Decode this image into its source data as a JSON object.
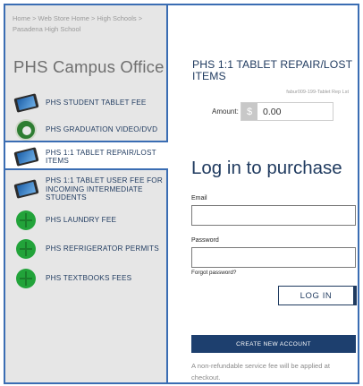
{
  "breadcrumb": "Home > Web Store Home > High Schools > Pasadena High School",
  "campus_title": "PHS Campus Office",
  "sidebar": {
    "items": [
      {
        "label": "PHS STUDENT TABLET FEE",
        "icon": "tablet-icon"
      },
      {
        "label": "PHS GRADUATION VIDEO/DVD",
        "icon": "school-seal-icon"
      },
      {
        "label": "PHS 1:1 TABLET REPAIR/LOST ITEMS",
        "icon": "tablet-icon",
        "active": true
      },
      {
        "label": "PHS 1:1 TABLET USER FEE FOR INCOMING INTERMEDIATE STUDENTS",
        "icon": "tablet-icon"
      },
      {
        "label": "PHS LAUNDRY FEE",
        "icon": "green-leaf-icon"
      },
      {
        "label": "PHS REFRIGERATOR PERMITS",
        "icon": "green-leaf-icon"
      },
      {
        "label": "PHS TEXTBOOKS FEES",
        "icon": "green-leaf-icon"
      }
    ]
  },
  "product": {
    "title": "PHS 1:1 TABLET REPAIR/LOST ITEMS",
    "sku": "fabur009-199-Tablet Rep Lst",
    "amount_label": "Amount:",
    "currency_symbol": "$",
    "amount_value": "0.00"
  },
  "login": {
    "title": "Log in to purchase",
    "email_label": "Email",
    "password_label": "Password",
    "forgot_password": "Forgot password?",
    "login_button": "LOG IN",
    "create_account_button": "CREATE NEW ACCOUNT",
    "fee_note": "A non-refundable service fee will be applied at checkout."
  },
  "colors": {
    "accent": "#3a6db3",
    "navy": "#1d3f6e",
    "sidebar_bg": "#e6e6e6"
  }
}
